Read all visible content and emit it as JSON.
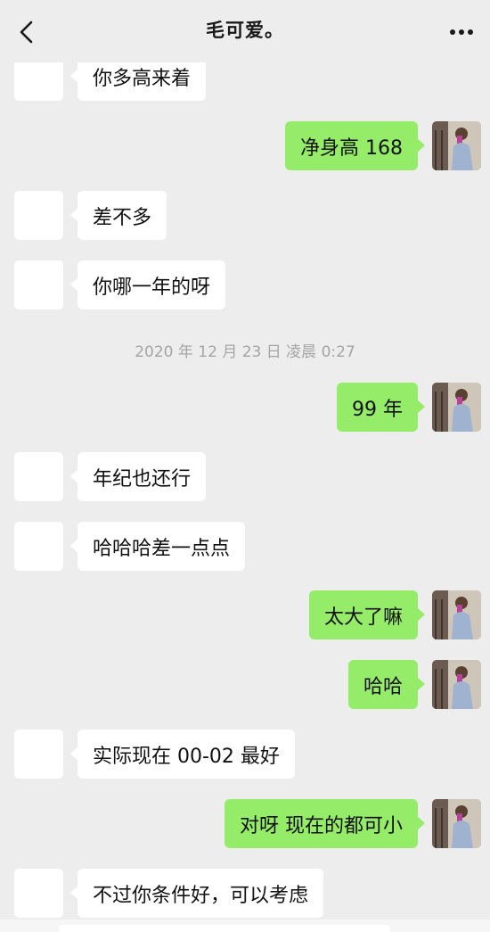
{
  "header": {
    "title": "毛可爱。",
    "back_icon": "chevron-left-icon",
    "more_icon": "more-horizontal-icon"
  },
  "colors": {
    "background": "#ededed",
    "incoming_bubble": "#ffffff",
    "outgoing_bubble": "#95ec69",
    "timestamp_text": "#a5a5a5"
  },
  "timestamp": "2020 年 12 月 23 日 凌晨 0:27",
  "messages": [
    {
      "side": "in",
      "text": "你多高来着"
    },
    {
      "side": "out",
      "text": "净身高 168"
    },
    {
      "side": "in",
      "text": "差不多"
    },
    {
      "side": "in",
      "text": "你哪一年的呀"
    },
    {
      "side": "out",
      "text": "99 年"
    },
    {
      "side": "in",
      "text": "年纪也还行"
    },
    {
      "side": "in",
      "text": "哈哈哈差一点点"
    },
    {
      "side": "out",
      "text": "太大了嘛"
    },
    {
      "side": "out",
      "text": "哈哈"
    },
    {
      "side": "in",
      "text": "实际现在 00-02 最好"
    },
    {
      "side": "out",
      "text": "对呀 现在的都可小"
    },
    {
      "side": "in",
      "text": "不过你条件好，可以考虑"
    }
  ]
}
